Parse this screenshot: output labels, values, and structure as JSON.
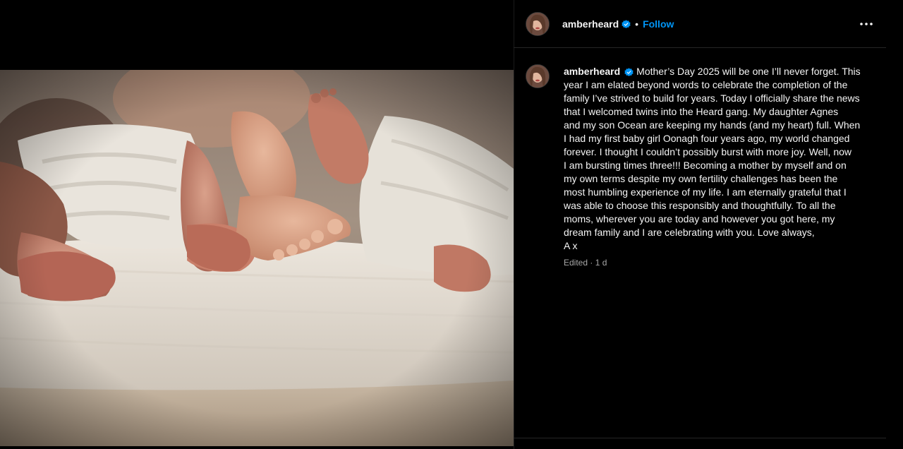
{
  "post": {
    "username": "amberheard",
    "follow_label": "Follow",
    "separator": "•",
    "caption_lines": [
      "Mother’s Day 2025 will be one I’ll never forget. This",
      "year I am elated beyond words to celebrate the completion of the",
      "family I’ve strived to build for years. Today I officially share the news",
      "that I welcomed twins into the Heard gang. My daughter Agnes",
      "and my son Ocean are keeping my hands (and my heart) full. When",
      "I had my first baby girl Oonagh four years ago, my world changed",
      "forever. I thought I couldn’t possibly burst with more joy. Well, now",
      "I am bursting times three!!! Becoming a mother by myself and on",
      "my own terms despite my own fertility challenges has been the",
      "most humbling experience of my life. I am eternally grateful that I",
      "was able to choose this responsibly and thoughtfully. To all the",
      "moms, wherever you are today and however you got here, my",
      "dream family and I are celebrating with you. Love always,",
      "A x"
    ],
    "meta": "Edited · 1 d",
    "icons": {
      "verified": "verified-badge-icon",
      "more": "more-options-icon"
    },
    "colors": {
      "background": "#000000",
      "accent": "#0095f6",
      "muted": "#a8a8a8",
      "divider": "#262626"
    }
  }
}
